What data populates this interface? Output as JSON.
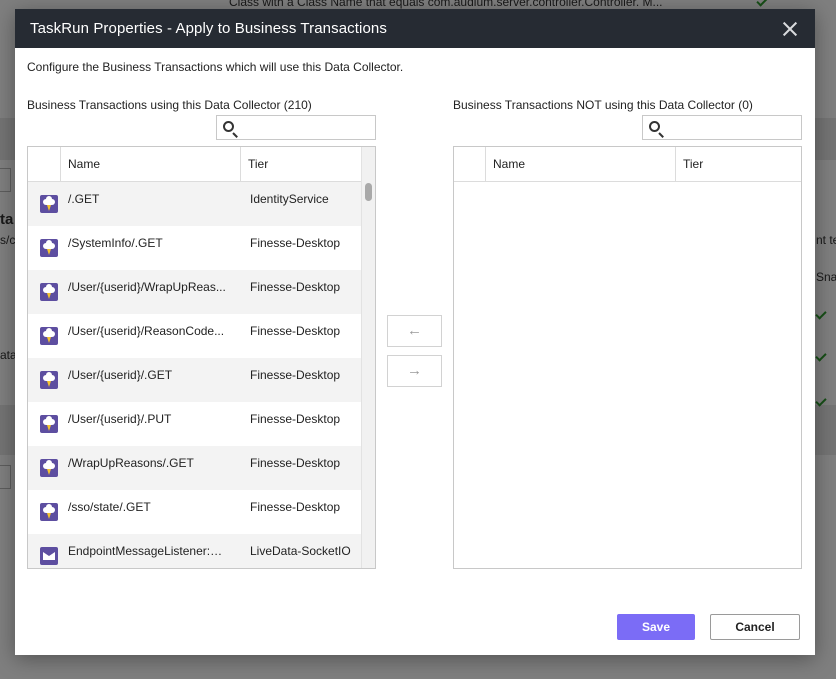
{
  "background": {
    "text_top": "Class with a Class Name that equals com.audium.server.controller.Controller. M...",
    "text_ta": "ta",
    "text_sc": "s/c",
    "text_data": "ata",
    "text_nt": "nt te",
    "text_sna": "Sna"
  },
  "modal": {
    "title": "TaskRun Properties - Apply to Business Transactions",
    "description": "Configure the Business Transactions which will use this Data Collector."
  },
  "left_panel": {
    "title": "Business Transactions using this Data Collector (210)",
    "search_placeholder": "",
    "columns": {
      "name": "Name",
      "tier": "Tier"
    },
    "rows": [
      {
        "icon": "cloud-bolt-icon",
        "name": "/.GET",
        "tier": "IdentityService"
      },
      {
        "icon": "cloud-bolt-icon",
        "name": "/SystemInfo/.GET",
        "tier": "Finesse-Desktop"
      },
      {
        "icon": "cloud-bolt-icon",
        "name": "/User/{userid}/WrapUpReas...",
        "tier": "Finesse-Desktop"
      },
      {
        "icon": "cloud-bolt-icon",
        "name": "/User/{userid}/ReasonCode...",
        "tier": "Finesse-Desktop"
      },
      {
        "icon": "cloud-bolt-icon",
        "name": "/User/{userid}/.GET",
        "tier": "Finesse-Desktop"
      },
      {
        "icon": "cloud-bolt-icon",
        "name": "/User/{userid}/.PUT",
        "tier": "Finesse-Desktop"
      },
      {
        "icon": "cloud-bolt-icon",
        "name": "/WrapUpReasons/.GET",
        "tier": "Finesse-Desktop"
      },
      {
        "icon": "cloud-bolt-icon",
        "name": "/sso/state/.GET",
        "tier": "Finesse-Desktop"
      },
      {
        "icon": "envelope-icon",
        "name": "EndpointMessageListener:C...",
        "tier": "LiveData-SocketIO"
      }
    ]
  },
  "right_panel": {
    "title": "Business Transactions NOT using this Data Collector (0)",
    "search_placeholder": "",
    "columns": {
      "name": "Name",
      "tier": "Tier"
    },
    "rows": []
  },
  "transfer": {
    "move_left_glyph": "←",
    "move_right_glyph": "→"
  },
  "footer": {
    "save_label": "Save",
    "cancel_label": "Cancel"
  },
  "colors": {
    "header_bg": "#262b33",
    "primary": "#7b6cf6",
    "icon_bg": "#5d4ea0"
  }
}
